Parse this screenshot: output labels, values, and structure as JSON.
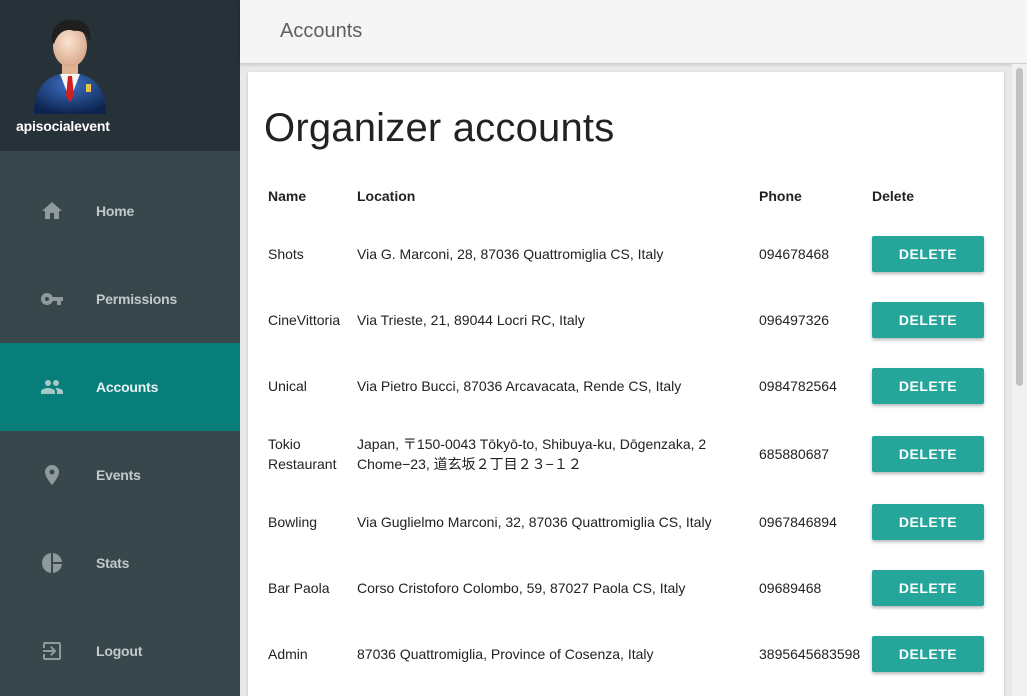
{
  "user": {
    "name": "apisocialevent"
  },
  "nav": [
    {
      "label": "Home",
      "icon": "home-icon"
    },
    {
      "label": "Permissions",
      "icon": "key-icon"
    },
    {
      "label": "Accounts",
      "icon": "people-icon",
      "active": true
    },
    {
      "label": "Events",
      "icon": "location-pin-icon"
    },
    {
      "label": "Stats",
      "icon": "pie-chart-icon"
    },
    {
      "label": "Logout",
      "icon": "logout-icon"
    }
  ],
  "topbar": {
    "title": "Accounts"
  },
  "page": {
    "title": "Organizer accounts"
  },
  "table": {
    "headers": {
      "name": "Name",
      "location": "Location",
      "phone": "Phone",
      "delete": "Delete"
    },
    "delete_label": "DELETE",
    "rows": [
      {
        "name": "Shots",
        "location": "Via G. Marconi, 28, 87036 Quattromiglia CS, Italy",
        "phone": "094678468"
      },
      {
        "name": "CineVittoria",
        "location": "Via Trieste, 21, 89044 Locri RC, Italy",
        "phone": "096497326"
      },
      {
        "name": "Unical",
        "location": "Via Pietro Bucci, 87036 Arcavacata, Rende CS, Italy",
        "phone": "0984782564"
      },
      {
        "name": "Tokio Restaurant",
        "location": "Japan, 〒150-0043 Tōkyō-to, Shibuya-ku, Dōgenzaka, 2 Chome−23, 道玄坂２丁目２３−１２",
        "phone": "685880687"
      },
      {
        "name": "Bowling",
        "location": "Via Guglielmo Marconi, 32, 87036 Quattromiglia CS, Italy",
        "phone": "0967846894"
      },
      {
        "name": "Bar Paola",
        "location": "Corso Cristoforo Colombo, 59, 87027 Paola CS, Italy",
        "phone": "09689468"
      },
      {
        "name": "Admin",
        "location": "87036 Quattromiglia, Province of Cosenza, Italy",
        "phone": "3895645683598"
      }
    ]
  },
  "colors": {
    "sidebar": "#37474b",
    "sidebar_header": "#263238",
    "active_nav": "#087e7b",
    "button": "#26a69a"
  }
}
